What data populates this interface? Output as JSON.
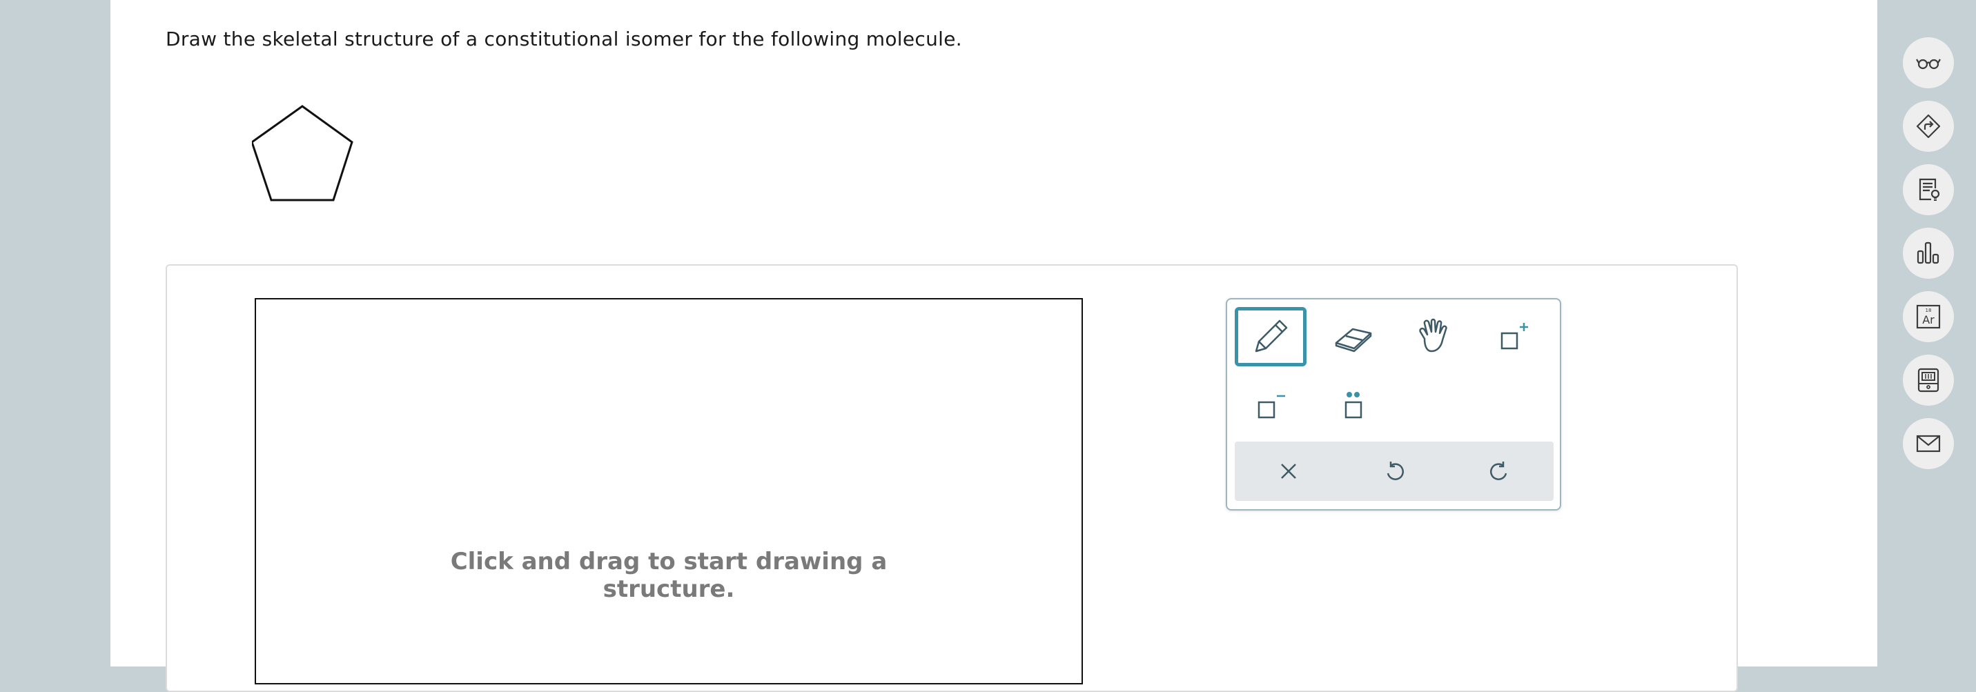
{
  "question": {
    "prompt": "Draw the skeletal structure of a constitutional isomer for the following molecule."
  },
  "molecule": {
    "shape": "cyclopentane-pentagon"
  },
  "canvas": {
    "hint_line1": "Click and drag to start drawing a",
    "hint_line2": "structure."
  },
  "toolbox": {
    "tools": [
      {
        "name": "pencil-tool",
        "icon": "pencil-icon",
        "active": true
      },
      {
        "name": "eraser-tool",
        "icon": "eraser-icon",
        "active": false
      },
      {
        "name": "hand-tool",
        "icon": "hand-icon",
        "active": false
      },
      {
        "name": "add-positive-charge-tool",
        "icon": "positive-charge-icon",
        "active": false
      },
      {
        "name": "add-negative-charge-tool",
        "icon": "negative-charge-icon",
        "active": false
      },
      {
        "name": "add-lone-pair-tool",
        "icon": "lone-pair-icon",
        "active": false
      }
    ],
    "actions": [
      {
        "name": "clear-button",
        "icon": "close-icon"
      },
      {
        "name": "undo-button",
        "icon": "undo-icon"
      },
      {
        "name": "redo-button",
        "icon": "redo-icon"
      }
    ],
    "accent_color": "#3a93a6",
    "icon_color": "#3d5a66"
  },
  "sidebar": {
    "buttons": [
      {
        "name": "explanation-button",
        "icon": "glasses-icon"
      },
      {
        "name": "directions-button",
        "icon": "route-icon"
      },
      {
        "name": "hint-button",
        "icon": "document-lightbulb-icon"
      },
      {
        "name": "reports-button",
        "icon": "bar-chart-icon"
      },
      {
        "name": "periodic-table-button",
        "icon": "periodic-element-icon",
        "element_symbol": "Ar",
        "atomic_number": "18"
      },
      {
        "name": "calculator-button",
        "icon": "calculator-icon"
      },
      {
        "name": "message-button",
        "icon": "envelope-icon"
      }
    ]
  }
}
